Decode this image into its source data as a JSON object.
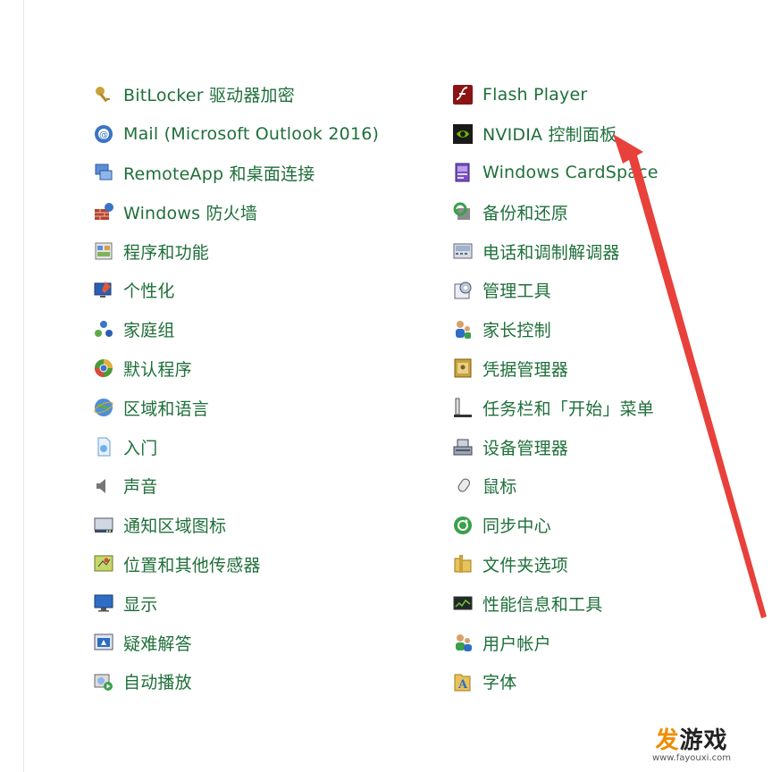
{
  "control_panel": {
    "left_items": [
      {
        "label": "BitLocker 驱动器加密",
        "icon": "bitlocker-key-icon"
      },
      {
        "label": "Mail (Microsoft Outlook 2016)",
        "icon": "mail-icon"
      },
      {
        "label": "RemoteApp 和桌面连接",
        "icon": "remoteapp-icon"
      },
      {
        "label": "Windows 防火墙",
        "icon": "firewall-icon"
      },
      {
        "label": "程序和功能",
        "icon": "programs-icon"
      },
      {
        "label": "个性化",
        "icon": "personalization-icon"
      },
      {
        "label": "家庭组",
        "icon": "homegroup-icon"
      },
      {
        "label": "默认程序",
        "icon": "default-programs-icon"
      },
      {
        "label": "区域和语言",
        "icon": "region-language-icon"
      },
      {
        "label": "入门",
        "icon": "getting-started-icon"
      },
      {
        "label": "声音",
        "icon": "speaker-icon"
      },
      {
        "label": "通知区域图标",
        "icon": "notification-area-icon"
      },
      {
        "label": "位置和其他传感器",
        "icon": "location-sensor-icon"
      },
      {
        "label": "显示",
        "icon": "display-icon"
      },
      {
        "label": "疑难解答",
        "icon": "troubleshooting-icon"
      },
      {
        "label": "自动播放",
        "icon": "autoplay-icon"
      }
    ],
    "right_items": [
      {
        "label": "Flash Player",
        "icon": "flash-player-icon"
      },
      {
        "label": "NVIDIA 控制面板",
        "icon": "nvidia-icon"
      },
      {
        "label": "Windows CardSpace",
        "icon": "cardspace-icon"
      },
      {
        "label": "备份和还原",
        "icon": "backup-restore-icon"
      },
      {
        "label": "电话和调制解调器",
        "icon": "phone-modem-icon"
      },
      {
        "label": "管理工具",
        "icon": "admin-tools-icon"
      },
      {
        "label": "家长控制",
        "icon": "parental-controls-icon"
      },
      {
        "label": "凭据管理器",
        "icon": "credential-manager-icon"
      },
      {
        "label": "任务栏和「开始」菜单",
        "icon": "taskbar-start-icon"
      },
      {
        "label": "设备管理器",
        "icon": "device-manager-icon"
      },
      {
        "label": "鼠标",
        "icon": "mouse-icon"
      },
      {
        "label": "同步中心",
        "icon": "sync-center-icon"
      },
      {
        "label": "文件夹选项",
        "icon": "folder-options-icon"
      },
      {
        "label": "性能信息和工具",
        "icon": "performance-icon"
      },
      {
        "label": "用户帐户",
        "icon": "user-accounts-icon"
      },
      {
        "label": "字体",
        "icon": "fonts-icon"
      }
    ]
  },
  "colors": {
    "link_text": "#1f6f3a",
    "arrow": "#e8403a"
  },
  "watermark": {
    "title_char": "发",
    "title_rest": "游戏",
    "url": "www.fayouxi.com"
  }
}
